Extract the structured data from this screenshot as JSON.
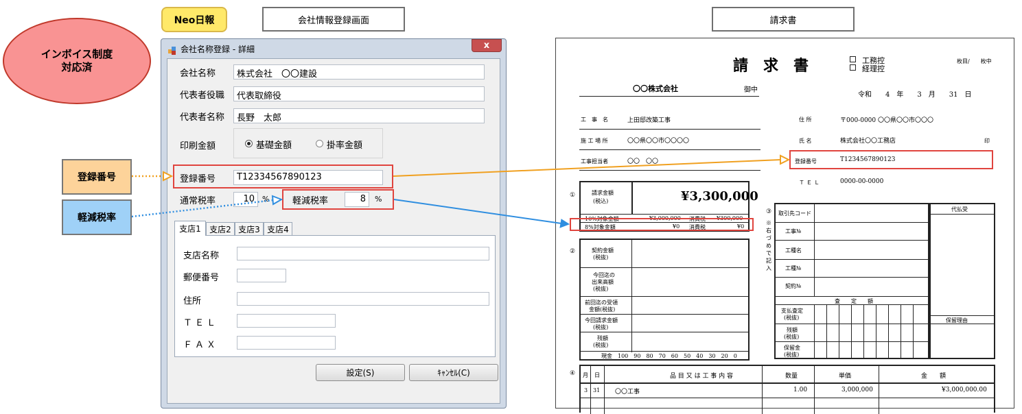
{
  "header": {
    "app_badge": "Neo日報",
    "screen_title": "会社情報登録画面",
    "invoice_title": "請求書"
  },
  "callout": {
    "invoice_ready_line1": "インボイス制度",
    "invoice_ready_line2": "対応済",
    "reg_label": "登録番号",
    "reduced_label": "軽減税率"
  },
  "colors": {
    "badge": "#ffe969",
    "ellipse": "#f99393",
    "reg_callout": "#fdd39a",
    "reduced_callout": "#9fd1f7",
    "orange_arrow": "#f0a020",
    "blue_arrow": "#2f8ee0",
    "highlight": "#e0443e"
  },
  "dialog": {
    "title": "会社名称登録 - 詳細",
    "close": "x",
    "company_name_label": "会社名称",
    "company_name_value": "株式会社　〇〇建設",
    "rep_title_label": "代表者役職",
    "rep_title_value": "代表取締役",
    "rep_name_label": "代表者名称",
    "rep_name_value": "長野　太郎",
    "print_amount_label": "印刷金額",
    "radio_base": "基礎金額",
    "radio_rate": "掛率金額",
    "selected_radio": "基礎金額",
    "reg_no_label": "登録番号",
    "reg_no_value": "T12334567890123",
    "normal_tax_label": "通常税率",
    "normal_tax_value": "10",
    "reduced_tax_label": "軽減税率",
    "reduced_tax_value": "8",
    "percent": "%",
    "tabs": [
      "支店1",
      "支店2",
      "支店3",
      "支店4"
    ],
    "branch_name_label": "支店名称",
    "postal_label": "郵便番号",
    "address_label": "住所",
    "tel_label": "ＴＥＬ",
    "fax_label": "ＦＡＸ",
    "ok_button": "設定(S)",
    "cancel_button": "ｷｬﾝｾﾙ(C)"
  },
  "invoice": {
    "title": "請　求　書",
    "check1": "工務控",
    "check2": "経理控",
    "page": "枚目/　　枚中",
    "addressee": "〇〇株式会社",
    "onchu": "御中",
    "date": "令和　　4　年　　3　月　　31　日",
    "project_label": "工　事　名",
    "project_value": "上田邸改築工事",
    "site_label": "施 工 場 所",
    "site_value": "〇〇県〇〇市〇〇〇〇",
    "staff_label": "工事担当者",
    "staff_value": "〇〇　〇〇",
    "address_label": "住 所",
    "address_value": "〒000-0000 〇〇県〇〇市〇〇〇",
    "name_label": "氏 名",
    "name_value": "株式会社〇〇工務店",
    "seal": "印",
    "reg_label": "登録番号",
    "reg_value": "T1234567890123",
    "tel_label": "ＴＥＬ",
    "tel_value": "0000-00-0000",
    "n1": "①",
    "n2": "②",
    "n3": "③",
    "n4": "④",
    "amount_label1": "請求金額",
    "amount_label2": "(税込)",
    "amount_value": "¥3,300,000",
    "r10_label": "10%対象金額",
    "r10_value": "¥3,000,000",
    "r10_tax_label": "消費税",
    "r10_tax_value": "¥300,000",
    "r8_label": "8%対象金額",
    "r8_value": "¥0",
    "r8_tax_label": "消費税",
    "r8_tax_value": "¥0",
    "contract1": "契約金額",
    "contract2": "(税抜)",
    "prog1": "今回迄の",
    "prog2": "出来高額",
    "prog3": "(税抜)",
    "prev1": "前回迄の受領",
    "prev2": "金額(税抜)",
    "cur1": "今回請求金額",
    "cur2": "(税抜)",
    "rem1": "残額",
    "rem2": "(税抜)",
    "cash_scale": "現金　100　90　80　70　60　50　40　30　20　0",
    "vertical_note": "※右づめで記入",
    "client_code": "取引先コード",
    "work_no": "工事№",
    "work_type_name": "工種名",
    "work_type_no": "工種№",
    "contract_no": "契約№",
    "assessed": "査　　定　　額",
    "pay_assess1": "支払査定",
    "pay_assess2": "(税抜)",
    "rest1": "残額",
    "rest2": "(税抜)",
    "hold1": "保留金",
    "hold2": "(税抜)",
    "substitute": "代払受",
    "hold_reason": "保留理由",
    "col_month": "月",
    "col_day": "日",
    "col_item": "品 目 又 は 工 事 内 容",
    "col_qty": "数量",
    "col_price": "単価",
    "col_amount": "金　　額",
    "row_month": "3",
    "row_day": "31",
    "row_item": "〇〇工事",
    "row_qty": "1.00",
    "row_price": "3,000,000",
    "row_amount": "¥3,000,000.00"
  }
}
